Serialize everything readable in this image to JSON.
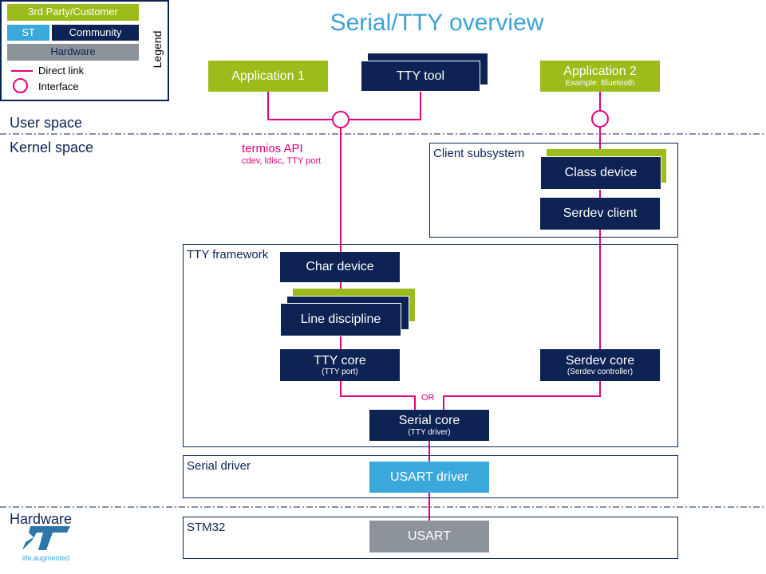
{
  "title": "Serial/TTY overview",
  "legend": {
    "title": "Legend",
    "third_party": "3rd Party/Customer",
    "st": "ST",
    "community": "Community",
    "hardware": "Hardware",
    "direct_link": "Direct link",
    "interface": "Interface"
  },
  "spaces": {
    "user": "User space",
    "kernel": "Kernel space",
    "hardware": "Hardware"
  },
  "termios": {
    "title": "termios API",
    "sub": "cdev, ldisc, TTY port"
  },
  "boxes": {
    "app1": "Application 1",
    "tty_tool": "TTY tool",
    "app2": "Application 2",
    "app2_sub": "Example: Bluetooth",
    "class_device": "Class device",
    "serdev_client": "Serdev client",
    "char_device": "Char device",
    "line_discipline": "Line discipline",
    "tty_core": "TTY  core",
    "tty_core_sub": "(TTY port)",
    "serdev_core": "Serdev core",
    "serdev_core_sub": "(Serdev controller)",
    "serial_core": "Serial core",
    "serial_core_sub": "(TTY driver)",
    "usart_driver": "USART driver",
    "usart": "USART"
  },
  "frames": {
    "client": "Client subsystem",
    "tty_framework": "TTY  framework",
    "serial_driver": "Serial driver",
    "stm32": "STM32"
  },
  "or_label": "OR",
  "logo": {
    "text": "life.augmented"
  },
  "colors": {
    "third_party": "#9bbc1a",
    "st": "#3aa8db",
    "community": "#0c2353",
    "hardware": "#8c939b",
    "link": "#e4007c",
    "title": "#3ba3d9"
  }
}
